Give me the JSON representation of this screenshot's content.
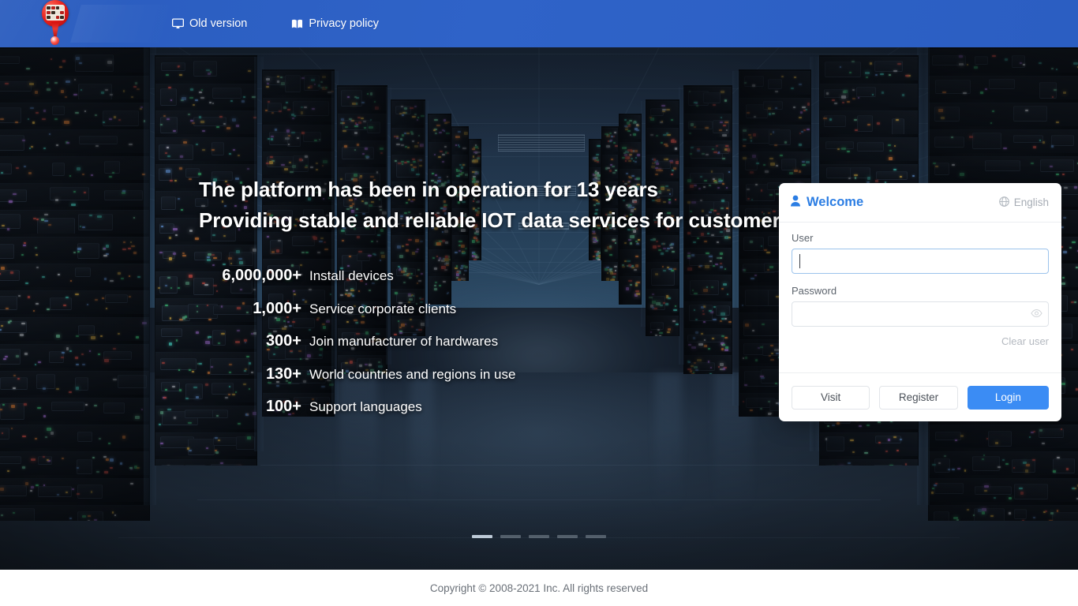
{
  "header": {
    "logo_name": "balloon-pin-logo",
    "nav": [
      {
        "label": "Old version",
        "icon": "monitor-icon"
      },
      {
        "label": "Privacy policy",
        "icon": "book-icon"
      }
    ]
  },
  "hero": {
    "headline_line1": "The platform has been in operation for 13 years",
    "headline_line2": "Providing stable and reliable IOT data services for customers",
    "stats": [
      {
        "number": "6,000,000+",
        "label": "Install devices"
      },
      {
        "number": "1,000+",
        "label": "Service corporate clients"
      },
      {
        "number": "300+",
        "label": "Join manufacturer of hardwares"
      },
      {
        "number": "130+",
        "label": "World countries and regions in use"
      },
      {
        "number": "100+",
        "label": "Support languages"
      }
    ],
    "carousel": {
      "count": 5,
      "active_index": 0
    }
  },
  "login": {
    "title": "Welcome",
    "title_icon": "user-icon",
    "language": {
      "label": "English",
      "icon": "globe-icon"
    },
    "user": {
      "label": "User",
      "value": "",
      "placeholder": "",
      "focused": true
    },
    "password": {
      "label": "Password",
      "value": "",
      "placeholder": "",
      "toggle_icon": "eye-icon"
    },
    "clear_user": "Clear user",
    "buttons": {
      "visit": "Visit",
      "register": "Register",
      "login": "Login"
    }
  },
  "footer": {
    "copyright": "Copyright © 2008-2021 Inc. All rights reserved"
  },
  "colors": {
    "header_blue": "#2d60c4",
    "primary_blue": "#3b8cf4",
    "title_blue": "#2b7de3",
    "logo_red": "#e8201c"
  }
}
